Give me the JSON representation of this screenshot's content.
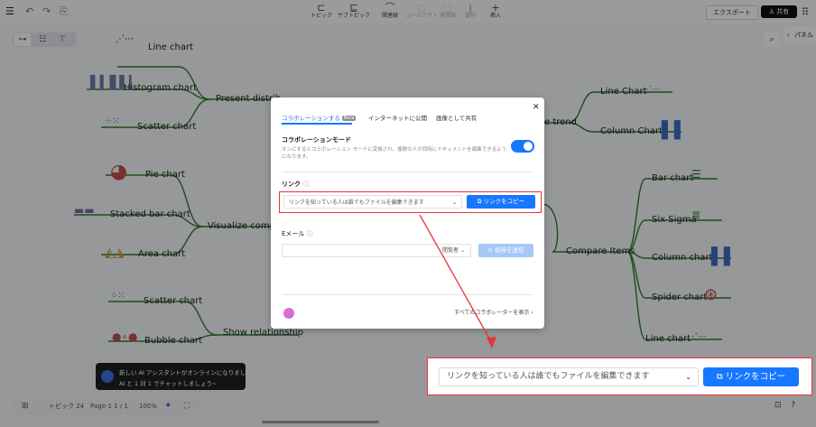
{
  "toolbar": {
    "topic": "トピック",
    "subtopic": "サブトピック",
    "relation": "関連線",
    "callout": "コールアウト",
    "summary": "境界線",
    "boundary": "要約",
    "insert": "挿入",
    "export": "エクスポート",
    "share": "共有"
  },
  "mindmap": {
    "left_mains": [
      "Present distrib",
      "Visualize compo",
      "Show relationship"
    ],
    "right_mains": [
      "e trend",
      "Compare Items"
    ],
    "left_leaves": [
      "Line chart",
      "Histogram chart",
      "Scatter chart",
      "Pie chart",
      "Stacked bar chart",
      "Area chart",
      "Scatter chart",
      "Bubble chart"
    ],
    "right_leaves": [
      "Line Chart",
      "Column Chart",
      "Bar chart",
      "Six Sigma",
      "Column chart",
      "Spider chart",
      "Line chart"
    ]
  },
  "panel_label": "パネル",
  "bottombar": {
    "topics": "トピック 24",
    "page": "Page-1  1 / 1",
    "zoom": "100%"
  },
  "ai_toast": {
    "line1": "新しい AI アシスタントがオンラインになりました!",
    "line2": "AI と 1 対 1 でチャットしましょう~"
  },
  "dialog": {
    "tabs": [
      "コラボレーションする",
      "インターネットに公開",
      "画像として共有"
    ],
    "beta": "Beta",
    "collab_title": "コラボレーションモード",
    "collab_desc": "オンにするとコラボレーション モードに変換され、複数の人が同時にドキュメントを編集できるようになります。",
    "link_title": "リンク",
    "link_option": "リンクを知っている人は誰でもファイルを編集できます",
    "copy_link": "リンクをコピー",
    "email_title": "Eメール",
    "role": "閲覧者",
    "invite": "招待を送信",
    "show_collaborators": "すべてのコラボレーターを表示"
  },
  "callout": {
    "link_option": "リンクを知っている人は誰でもファイルを編集できます",
    "copy_link": "リンクをコピー"
  },
  "colors": {
    "accent": "#1677ff",
    "highlight": "#e8333a",
    "branch": "#2e7d32"
  }
}
